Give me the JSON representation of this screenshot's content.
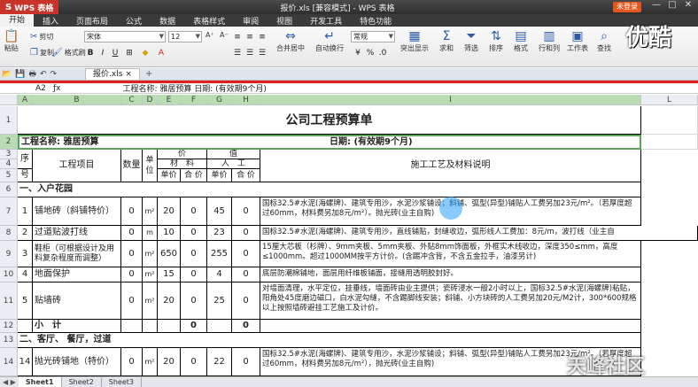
{
  "app": {
    "logo": "WPS 表格",
    "window_title": "报价.xls [兼容模式] - WPS 表格",
    "account": "未登录",
    "min": "—",
    "max": "□",
    "close": "✕"
  },
  "menu": [
    "开始",
    "插入",
    "页面布局",
    "公式",
    "数据",
    "表格样式",
    "审阅",
    "视图",
    "开发工具",
    "特色功能"
  ],
  "ribbon": {
    "paste": "粘贴",
    "cut": "剪切",
    "copy": "复制",
    "format_painter": "格式刷",
    "font_name": "宋体",
    "font_size": "12",
    "bold": "B",
    "italic": "I",
    "underline": "U",
    "font_grow": "A⁺",
    "font_shrink": "A⁻",
    "merge_center": "合并居中",
    "wrap_text": "自动换行",
    "number_format": "常规",
    "percent": "%",
    "cond_format": "突出显示",
    "sum": "求和",
    "filter": "筛选",
    "sort": "排序",
    "format": "格式",
    "row_col": "行和列",
    "worksheet": "工作表",
    "find": "查找"
  },
  "watermark": "优酷",
  "tab": {
    "file": "报价.xls",
    "close": "×",
    "add": "+"
  },
  "formula": {
    "namebox": "A2",
    "content": "工程名称:   雅居预算                                   日期:     (有效期9个月)"
  },
  "columns": [
    "A",
    "B",
    "C",
    "D",
    "E",
    "F",
    "G",
    "H",
    "I",
    "L"
  ],
  "rows": {
    "r1": "1",
    "r2": "2",
    "r3": "3",
    "r4": "4",
    "r5": "5",
    "r6": "6",
    "r7": "7",
    "r8": "8",
    "r9": "9",
    "r10": "10",
    "r11": "11",
    "r12": "12",
    "r13": "13",
    "r14": "14"
  },
  "sheet": {
    "title": "公司工程预算单",
    "project_name": "工程名称:   雅居预算",
    "date": "日期:     (有效期9个月)",
    "h_seq_top": "序",
    "h_seq_bottom": "号",
    "h_item": "工程项目",
    "h_qty": "数量",
    "h_unit": "单位",
    "h_price_top": "价",
    "h_price_top2": "值",
    "h_material": "材　料",
    "h_labor": "人　工",
    "h_unit_price": "单价",
    "h_total": "合 价",
    "h_unit_price2": "单价",
    "h_total2": "合 价",
    "h_desc": "施工工艺及材料说明",
    "sec1": "一、入户花园",
    "sec2": "二、客厅、 餐厅，过道",
    "items": [
      {
        "no": "1",
        "name": "铺地砖（斜铺特价）",
        "qty": "0",
        "unit": "m²",
        "mp": "20",
        "mt": "0",
        "lp": "45",
        "lt": "0",
        "desc": "国标32.5#水泥(海螺牌)、建筑专用沙，水泥沙浆铺设；斜铺、弧型(异型)铺贴人工费另加23元/m²。（若厚度超过60mm，材料费另加8元/m²）。抛光砖(业主自购)"
      },
      {
        "no": "2",
        "name": "过道贴波打线",
        "qty": "0",
        "unit": "m",
        "mp": "10",
        "mt": "0",
        "lp": "23",
        "lt": "0",
        "desc": "国标32.5#水泥(海螺牌)、建筑专用沙，直线铺贴，封缝收边，弧形线人工费加：8元/m，波打线（业主自"
      },
      {
        "no": "3",
        "name": "鞋柜（可根据设计及用料复杂程度而调整）",
        "qty": "0",
        "unit": "m²",
        "mp": "650",
        "mt": "0",
        "lp": "255",
        "lt": "0",
        "desc": "15厘大芯板（杉牌）、9mm夹板、5mm夹板、外贴8mm饰面板，外框实木线收边，深度350≤mm，高度≤1000mm。超过1000MM按平方计价。(含踢冲含背，不含五金拉手，油漆另计)"
      },
      {
        "no": "4",
        "name": "地面保护",
        "qty": "0",
        "unit": "m²",
        "mp": "15",
        "mt": "0",
        "lp": "4",
        "lt": "0",
        "desc": "底层防潮棉铺地，面层用纤维板铺面，接缝用透明胶封好。"
      },
      {
        "no": "5",
        "name": "贴墙砖",
        "qty": "0",
        "unit": "m²",
        "mp": "20",
        "mt": "0",
        "lp": "25",
        "lt": "0",
        "desc": "对墙面清理，水平定位，挂垂线，墙面砖由业主提供；瓷砖浸水一般2小时以上，国标32.5#水泥(海螺牌)粘贴，阳角处45度磨边磁口，白水泥勾缝，不含踢脚线安装；斜铺、小方块砖的人工费另加20元/M2计，300*600规格以上按照墙砖避挂工艺施工及计价。"
      },
      {
        "no": "14",
        "name": "抛光砖铺地（特价）",
        "qty": "0",
        "unit": "m²",
        "mp": "20",
        "mt": "0",
        "lp": "22",
        "lt": "0",
        "desc": "国标32.5#水泥(海螺牌)、建筑专用沙，水泥沙浆铺设；斜铺、弧型(异型)铺贴人工费另加23元/m²。（若厚度超过60mm，材料费另加8元/m²），抛光砖(业主自购)"
      }
    ],
    "subtotal": "小　计",
    "subtotal_mt": "0",
    "subtotal_lt": "0"
  },
  "sheets": [
    "Sheet1",
    "Sheet2",
    "Sheet3"
  ],
  "sheet_nav": "◀ ▶",
  "watermark2": "天峰社区"
}
